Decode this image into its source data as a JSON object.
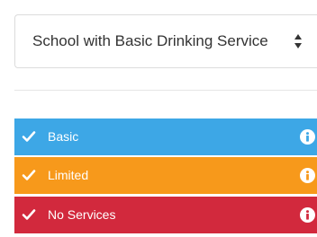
{
  "filter": {
    "selected_value": "School with Basic Drinking Service"
  },
  "legend": {
    "items": [
      {
        "label": "Basic",
        "color": "#3da7e6"
      },
      {
        "label": "Limited",
        "color": "#f7991b"
      },
      {
        "label": "No Services",
        "color": "#d2293d"
      }
    ]
  },
  "icons": {
    "row_check": "check-icon",
    "row_info": "info-icon",
    "select_arrows": "sort-arrows-icon"
  },
  "colors": {
    "text": "#333333",
    "border": "#dcdcdc"
  }
}
